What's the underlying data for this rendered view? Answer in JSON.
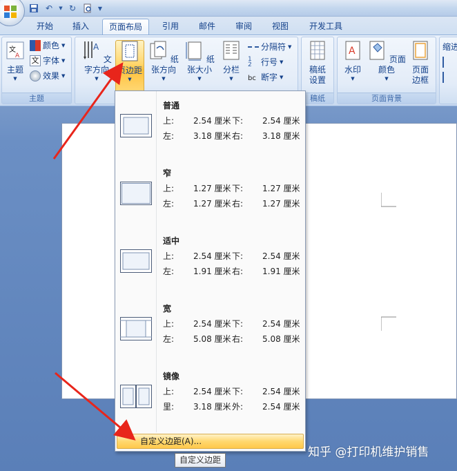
{
  "tabs": [
    "开始",
    "插入",
    "页面布局",
    "引用",
    "邮件",
    "审阅",
    "视图",
    "开发工具"
  ],
  "ribbon": {
    "themes": {
      "main": "主题",
      "color": "颜色",
      "font": "字体",
      "effect": "效果",
      "group": "主题"
    },
    "page_setup": {
      "text_dir": "文字方向",
      "margins": "页边距",
      "orientation": "纸张方向",
      "size": "纸张大小",
      "columns": "分栏",
      "breaks": "分隔符",
      "line_numbers": "行号",
      "hyphen": "断字"
    },
    "manuscript": {
      "btn1": "稿纸",
      "btn2": "设置",
      "group": "稿纸"
    },
    "background": {
      "watermark": "水印",
      "page_color": "页面颜色",
      "page_border1": "页面",
      "page_border2": "边框",
      "group": "页面背景"
    },
    "indent": {
      "label": "缩进"
    }
  },
  "margins_menu": [
    {
      "name": "普通",
      "r1": [
        "上:",
        "2.54 厘米",
        "下:",
        "2.54 厘米"
      ],
      "r2": [
        "左:",
        "3.18 厘米",
        "右:",
        "3.18 厘米"
      ]
    },
    {
      "name": "窄",
      "r1": [
        "上:",
        "1.27 厘米",
        "下:",
        "1.27 厘米"
      ],
      "r2": [
        "左:",
        "1.27 厘米",
        "右:",
        "1.27 厘米"
      ]
    },
    {
      "name": "适中",
      "r1": [
        "上:",
        "2.54 厘米",
        "下:",
        "2.54 厘米"
      ],
      "r2": [
        "左:",
        "1.91 厘米",
        "右:",
        "1.91 厘米"
      ]
    },
    {
      "name": "宽",
      "r1": [
        "上:",
        "2.54 厘米",
        "下:",
        "2.54 厘米"
      ],
      "r2": [
        "左:",
        "5.08 厘米",
        "右:",
        "5.08 厘米"
      ]
    },
    {
      "name": "镜像",
      "r1": [
        "上:",
        "2.54 厘米",
        "下:",
        "2.54 厘米"
      ],
      "r2": [
        "里:",
        "3.18 厘米",
        "外:",
        "2.54 厘米"
      ]
    }
  ],
  "custom_margins": "自定义边距(A)...",
  "tooltip": "自定义边距",
  "watermark": "知乎 @打印机维护销售",
  "colors": {
    "accent": "#15428b",
    "highlight": "#ffc84a",
    "arrow": "#e8251b"
  }
}
